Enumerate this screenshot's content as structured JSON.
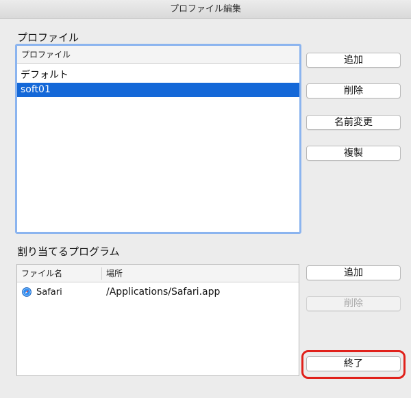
{
  "window": {
    "title": "プロファイル編集"
  },
  "profiles": {
    "section_label": "プロファイル",
    "column_header": "プロファイル",
    "items": [
      "デフォルト",
      "soft01"
    ],
    "selected_index": 1,
    "buttons": {
      "add": "追加",
      "delete": "削除",
      "rename": "名前変更",
      "duplicate": "複製"
    }
  },
  "programs": {
    "section_label": "割り当てるプログラム",
    "columns": {
      "name": "ファイル名",
      "location": "場所"
    },
    "rows": [
      {
        "name": "Safari",
        "location": "/Applications/Safari.app",
        "icon": "safari-compass-icon"
      }
    ],
    "buttons": {
      "add": "追加",
      "delete": "削除",
      "delete_enabled": false
    }
  },
  "footer": {
    "close_button": "終了"
  },
  "colors": {
    "selection": "#1468d8",
    "focus_ring": "#8bb4ef",
    "highlight": "#e0211b"
  }
}
